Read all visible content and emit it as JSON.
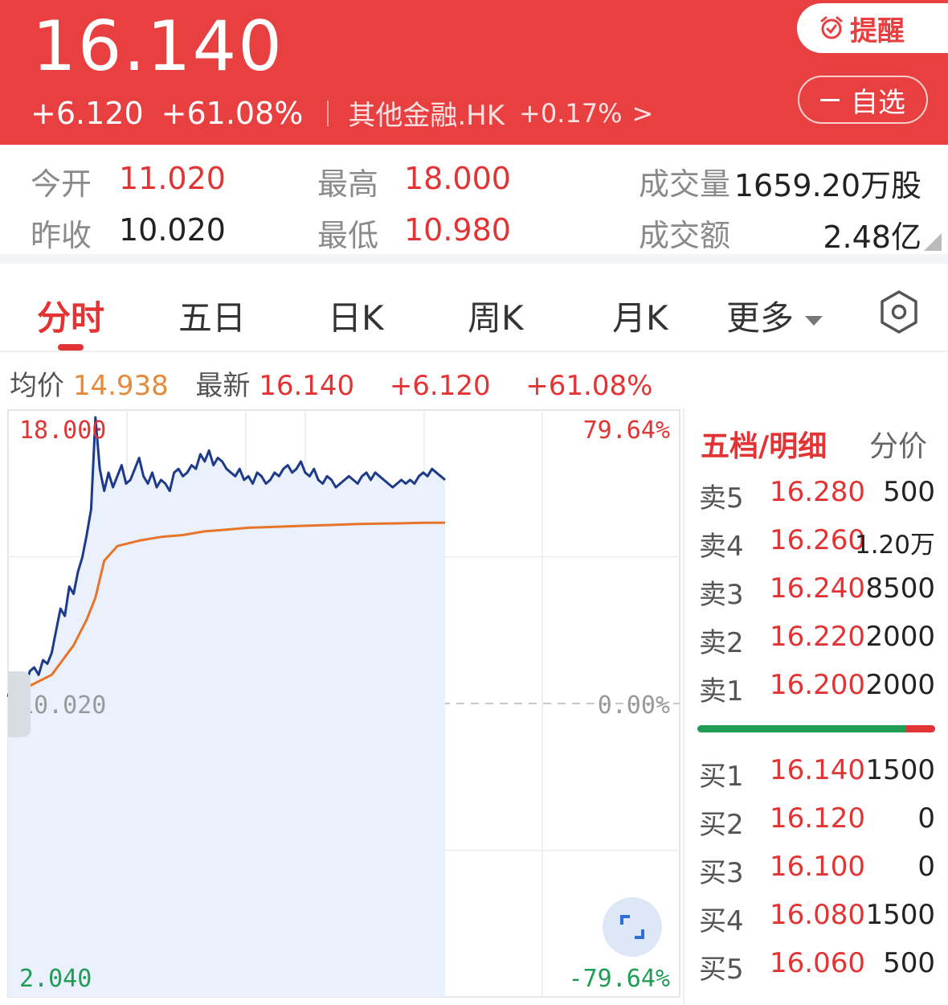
{
  "header": {
    "price": "16.140",
    "change": "+6.120",
    "change_pct": "+61.08%",
    "sector_name": "其他金融.HK",
    "sector_pct": "+0.17%",
    "chevron": ">",
    "alert_label": "提醒",
    "watch_label": "自选"
  },
  "stats": {
    "open_label": "今开",
    "open": "11.020",
    "prev_close_label": "昨收",
    "prev_close": "10.020",
    "high_label": "最高",
    "high": "18.000",
    "low_label": "最低",
    "low": "10.980",
    "volume_label": "成交量",
    "volume": "1659.20万股",
    "turnover_label": "成交额",
    "turnover": "2.48亿"
  },
  "tabs": [
    {
      "label": "分时",
      "active": true
    },
    {
      "label": "五日"
    },
    {
      "label": "日K"
    },
    {
      "label": "周K"
    },
    {
      "label": "月K"
    },
    {
      "label": "更多"
    }
  ],
  "info": {
    "avg_label": "均价",
    "avg": "14.938",
    "last_label": "最新",
    "last": "16.140",
    "change": "+6.120",
    "change_pct": "+61.08%"
  },
  "chart_axes": {
    "y_top": "18.000",
    "y_mid": "10.020",
    "y_bottom": "2.040",
    "pct_top": "79.64%",
    "pct_mid": "0.00%",
    "pct_bottom": "-79.64%"
  },
  "chart_data": {
    "type": "line",
    "ylim": [
      2.04,
      18.0
    ],
    "baseline": 10.02,
    "x_range": [
      0,
      100
    ],
    "series": [
      {
        "key": "price",
        "color": "#1e3a8a",
        "x": [
          0,
          1,
          2,
          3,
          4,
          5,
          6,
          7,
          8,
          9,
          10,
          11,
          12,
          13,
          14,
          15,
          16,
          17,
          18,
          19,
          20,
          21,
          22,
          23,
          24,
          25,
          26,
          27,
          28,
          29,
          30,
          31,
          32,
          33,
          34,
          35,
          36,
          37,
          38,
          39,
          40,
          41,
          42,
          43,
          44,
          45,
          46,
          47,
          48,
          49,
          50,
          51,
          52,
          53,
          54,
          55,
          56,
          57,
          58,
          59,
          60,
          61,
          62,
          63,
          64,
          65,
          66,
          67,
          68,
          69,
          70,
          71,
          72,
          73,
          74,
          75,
          76,
          77,
          78,
          79,
          80,
          81,
          82,
          83,
          84,
          85,
          86,
          87,
          88,
          89,
          90,
          91,
          92,
          93,
          94,
          95,
          96,
          97,
          98,
          99,
          100
        ],
        "values": [
          10.2,
          10.6,
          10.3,
          10.7,
          10.5,
          10.9,
          11.0,
          10.8,
          11.2,
          11.1,
          11.4,
          12.0,
          12.6,
          12.4,
          13.2,
          13.0,
          13.6,
          14.0,
          14.6,
          15.3,
          17.8,
          16.4,
          15.8,
          16.3,
          15.9,
          16.2,
          16.5,
          16.0,
          16.1,
          16.4,
          16.7,
          16.2,
          16.0,
          16.3,
          15.9,
          16.1,
          16.0,
          15.8,
          16.3,
          16.4,
          16.2,
          16.3,
          16.5,
          16.4,
          16.8,
          16.6,
          16.9,
          16.5,
          16.7,
          16.6,
          16.4,
          16.3,
          16.2,
          16.4,
          16.1,
          16.2,
          16.0,
          16.3,
          16.2,
          16.0,
          16.1,
          16.3,
          16.2,
          16.4,
          16.5,
          16.3,
          16.4,
          16.6,
          16.3,
          16.2,
          16.4,
          16.1,
          16.0,
          16.2,
          16.1,
          15.9,
          16.0,
          16.1,
          16.2,
          16.1,
          16.0,
          16.2,
          16.3,
          16.1,
          16.3,
          16.2,
          16.1,
          16.0,
          15.9,
          16.0,
          16.1,
          16.0,
          16.1,
          16.0,
          16.2,
          16.3,
          16.2,
          16.4,
          16.3,
          16.2,
          16.1
        ]
      },
      {
        "key": "avg_price",
        "color": "#e8742a",
        "x": [
          0,
          5,
          10,
          15,
          18,
          20,
          22,
          25,
          30,
          35,
          40,
          45,
          50,
          55,
          60,
          65,
          70,
          75,
          80,
          85,
          90,
          95,
          100
        ],
        "values": [
          10.2,
          10.5,
          10.8,
          11.6,
          12.3,
          12.9,
          13.9,
          14.3,
          14.45,
          14.55,
          14.6,
          14.7,
          14.75,
          14.8,
          14.82,
          14.84,
          14.86,
          14.88,
          14.9,
          14.91,
          14.92,
          14.935,
          14.938
        ]
      }
    ]
  },
  "order_book": {
    "tab_active": "五档/明细",
    "tab_alt": "分价",
    "sell_ratio": 0.12,
    "asks": [
      {
        "label": "卖5",
        "price": "16.280",
        "vol": "500"
      },
      {
        "label": "卖4",
        "price": "16.260",
        "vol": "1.20万"
      },
      {
        "label": "卖3",
        "price": "16.240",
        "vol": "8500"
      },
      {
        "label": "卖2",
        "price": "16.220",
        "vol": "2000"
      },
      {
        "label": "卖1",
        "price": "16.200",
        "vol": "2000"
      }
    ],
    "bids": [
      {
        "label": "买1",
        "price": "16.140",
        "vol": "1500"
      },
      {
        "label": "买2",
        "price": "16.120",
        "vol": "0"
      },
      {
        "label": "买3",
        "price": "16.100",
        "vol": "0"
      },
      {
        "label": "买4",
        "price": "16.080",
        "vol": "1500"
      },
      {
        "label": "买5",
        "price": "16.060",
        "vol": "500"
      }
    ]
  },
  "colors": {
    "header_bg": "#e84040",
    "up": "#e23434",
    "down": "#1f9d55",
    "avg_text": "#e58a3a"
  },
  "icons": [
    "alarm-clock-icon",
    "minus-icon",
    "settings-hexagon-icon",
    "fullscreen-icon",
    "chevron-down-icon"
  ]
}
